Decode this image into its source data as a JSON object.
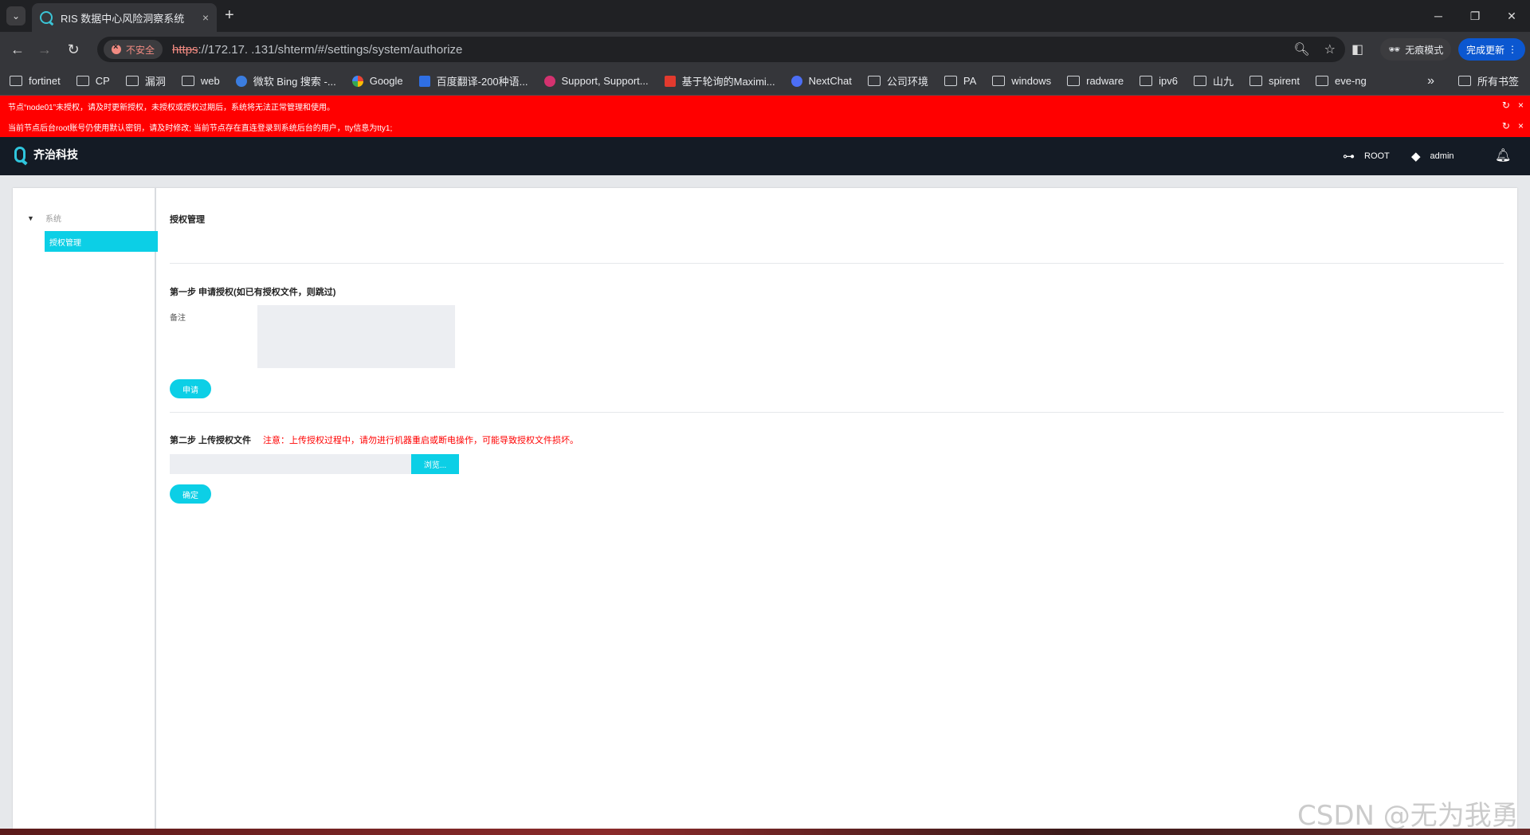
{
  "browser": {
    "tab_title": "RIS 数据中心风险洞察系统",
    "tab_close": "×",
    "new_tab": "+",
    "insecure_label": "不安全",
    "url_scheme": "https",
    "url_rest": "://172.17. .131/shterm/#/settings/system/authorize",
    "incognito_label": "无痕模式",
    "update_label": "完成更新",
    "bookmarks": [
      "fortinet",
      "CP",
      "漏洞",
      "web",
      "微软 Bing 搜索 -...",
      "Google",
      "百度翻译-200种语...",
      "Support, Support...",
      "基于轮询的Maximi...",
      "NextChat",
      "公司环境",
      "PA",
      "windows",
      "radware",
      "ipv6",
      "山九",
      "spirent",
      "eve-ng"
    ],
    "bookmarks_more": "»",
    "all_bookmarks": "所有书签"
  },
  "alerts": [
    "节点“node01”未授权，请及时更新授权，未授权或授权过期后，系统将无法正常管理和使用。",
    "当前节点后台root账号仍使用默认密钥，请及时修改; 当前节点存在直连登录到系统后台的用户，tty信息为tty1;"
  ],
  "app": {
    "logo_text": "齐治科技",
    "root_label": "ROOT",
    "user_label": "admin"
  },
  "sidebar": {
    "root_label": "系统",
    "active_item": "授权管理"
  },
  "main": {
    "title": "授权管理",
    "step1_title": "第一步 申请授权(如已有授权文件，则跳过)",
    "note_label": "备注",
    "note_value": "",
    "apply_button": "申请",
    "step2_title": "第二步 上传授权文件",
    "step2_warning": "注意：上传授权过程中，请勿进行机器重启或断电操作，可能导致授权文件损坏。",
    "file_value": "",
    "browse_button": "浏览...",
    "ok_button": "确定"
  },
  "watermark": "CSDN @无为我勇",
  "colors": {
    "accent": "#0ccfe6",
    "alert": "#ff0000",
    "header": "#141b25"
  }
}
